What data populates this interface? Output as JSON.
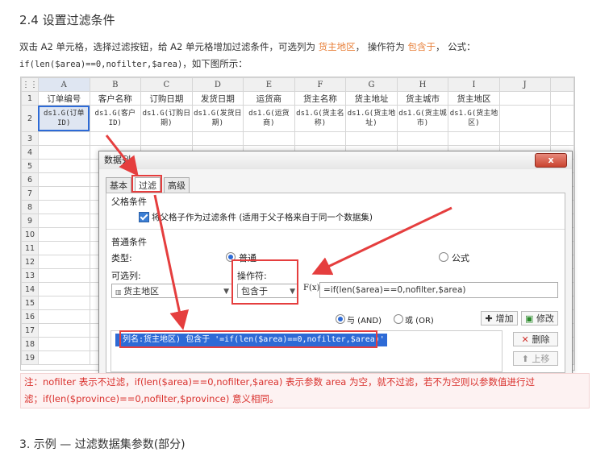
{
  "section_title": "2.4 设置过滤条件",
  "paragraph": {
    "p1": "双击 A2 单元格，选择过滤按钮，给 A2 单元格增加过滤条件，可选列为 ",
    "kw1": "货主地区",
    "p2": "， 操作符为 ",
    "kw2": "包含于",
    "p3": "， 公式：",
    "formula": "if(len($area)==0,nofilter,$area)",
    "p4": "，如下图所示："
  },
  "sheet": {
    "columns": [
      "A",
      "B",
      "C",
      "D",
      "E",
      "F",
      "G",
      "H",
      "I",
      "J"
    ],
    "rows": [
      "1",
      "2",
      "3",
      "4",
      "5",
      "6",
      "7",
      "8",
      "9",
      "10",
      "11",
      "12",
      "13",
      "14",
      "15",
      "16",
      "17",
      "18",
      "19"
    ],
    "header_row": [
      "订单编号",
      "客户名称",
      "订购日期",
      "发货日期",
      "运货商",
      "货主名称",
      "货主地址",
      "货主城市",
      "货主地区"
    ],
    "data_row": [
      "ds1.G(订单ID)",
      "ds1.G(客户ID)",
      "ds1.G(订购日期)",
      "ds1.G(发货日期)",
      "ds1.G(运货商)",
      "ds1.G(货主名称)",
      "ds1.G(货主地址)",
      "ds1.G(货主城市)",
      "ds1.G(货主地区)"
    ]
  },
  "dialog": {
    "title": "数据列",
    "close": "x",
    "tabs": [
      "基本",
      "过滤",
      "高级"
    ],
    "parent_group": "父格条件",
    "parent_checkbox": "将父格子作为过滤条件 (适用于父子格来自于同一个数据集)",
    "normal_group": "普通条件",
    "type_label": "类型:",
    "type_normal": "普通",
    "type_formula": "公式",
    "optional_column_label": "可选列:",
    "optional_column_value": "货主地区",
    "operator_label": "操作符:",
    "operator_value": "包含于",
    "fx_label": "F(x)",
    "formula_value": "=if(len($area)==0,nofilter,$area)",
    "and_label": "与 (AND)",
    "or_label": "或 (OR)",
    "add_button": "增加",
    "modify_button": "修改",
    "delete_button": "删除",
    "up_button": "上移",
    "condition_item": "(列名:货主地区) 包含于 '=if(len($area)==0,nofilter,$area)'"
  },
  "note": {
    "line1": "注：nofilter 表示不过滤，if(len($area)==0,nofilter,$area) 表示参数 area 为空，就不过滤，若不为空则以参数值进行过",
    "line2": "滤；if(len($province)==0,nofilter,$province) 意义相同。"
  },
  "next_heading": "3. 示例 — 过滤数据集参数(部分)"
}
